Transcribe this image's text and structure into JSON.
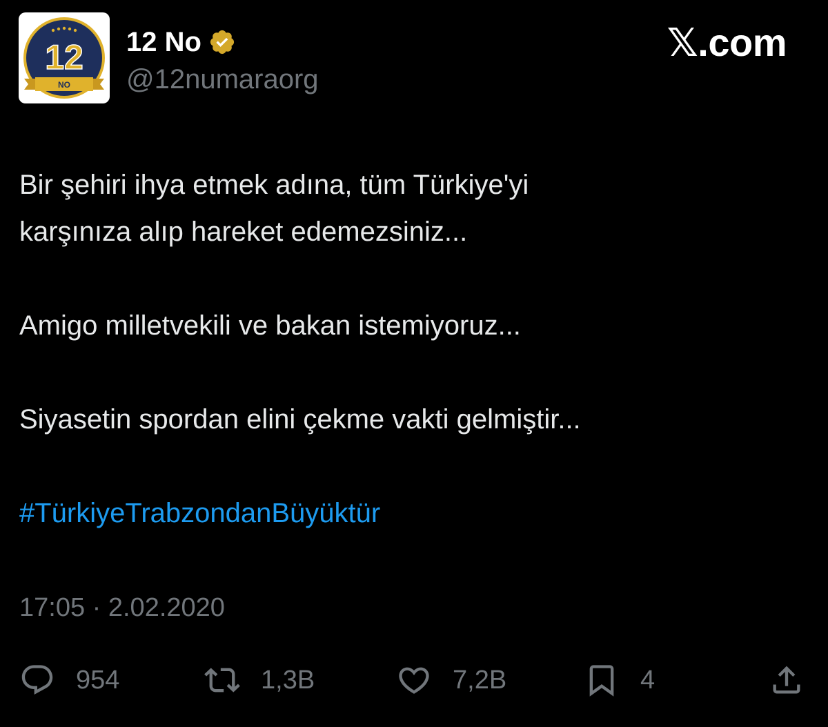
{
  "account": {
    "display_name": "12 No",
    "handle": "@12numaraorg",
    "avatar_text": "12",
    "avatar_subtext": "NO",
    "verified": true,
    "verified_color": "#d4a82a"
  },
  "brand": {
    "label": "𝕏.com"
  },
  "tweet": {
    "paragraphs": [
      "Bir şehiri ihya etmek adına, tüm Türkiye'yi",
      "karşınıza alıp hareket edemezsiniz...",
      "Amigo milletvekili ve bakan istemiyoruz...",
      "Siyasetin spordan elini çekme vakti gelmiştir..."
    ],
    "hashtag": "#TürkiyeTrabzondanBüyüktür",
    "timestamp": "17:05 · 2.02.2020"
  },
  "stats": {
    "replies": "954",
    "retweets": "1,3B",
    "likes": "7,2B",
    "bookmarks": "4"
  },
  "colors": {
    "background": "#000000",
    "text": "#e7e9ea",
    "muted": "#71767b",
    "link": "#1d9bf0",
    "avatar_navy": "#1e2f5c",
    "avatar_gold": "#e0b22c"
  }
}
